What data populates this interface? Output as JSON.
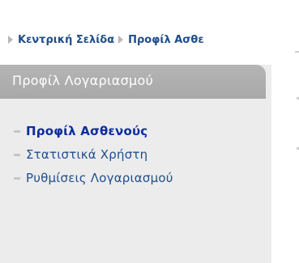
{
  "breadcrumb": {
    "items": [
      {
        "label": "Κεντρική Σελίδα"
      },
      {
        "label": "Προφίλ Ασθε"
      }
    ]
  },
  "panel": {
    "title": "Προφίλ Λογαριασμού",
    "menu": [
      {
        "label": "Προφίλ Ασθενούς",
        "active": true
      },
      {
        "label": "Στατιστικά Χρήστη",
        "active": false
      },
      {
        "label": "Ρυθμίσεις Λογαριασμού",
        "active": false
      }
    ]
  },
  "icons": {
    "breadcrumb_separator": "triangle-right-icon",
    "menu_bullet": "dash-bullet-icon"
  },
  "colors": {
    "link": "#1f4e8c",
    "active_link": "#0b2c9e",
    "panel_header": "#aaaaaa",
    "panel_body": "#ececec"
  }
}
